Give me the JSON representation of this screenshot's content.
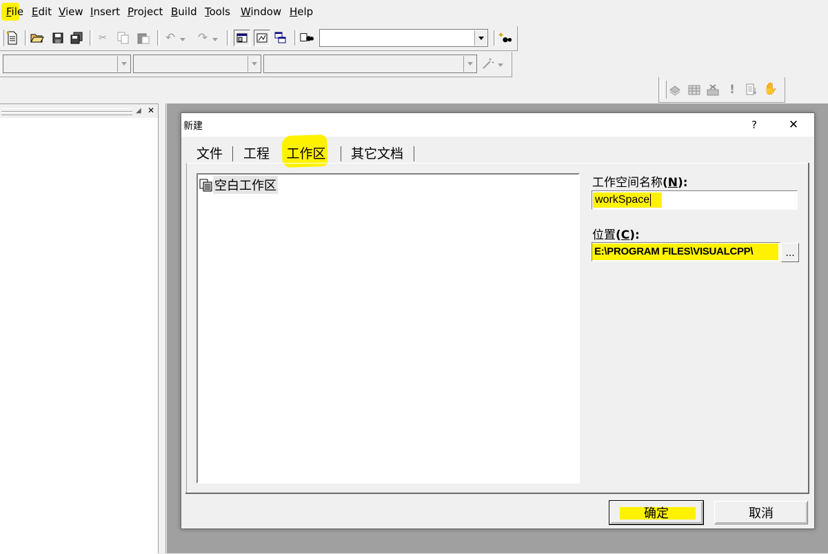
{
  "menu": {
    "items": [
      {
        "label": "File",
        "hotkey": "F",
        "rest": "ile"
      },
      {
        "label": "Edit",
        "hotkey": "E",
        "rest": "dit"
      },
      {
        "label": "View",
        "hotkey": "V",
        "rest": "iew"
      },
      {
        "label": "Insert",
        "hotkey": "I",
        "rest": "nsert"
      },
      {
        "label": "Project",
        "hotkey": "P",
        "rest": "roject"
      },
      {
        "label": "Build",
        "hotkey": "B",
        "rest": "uild"
      },
      {
        "label": "Tools",
        "hotkey": "T",
        "rest": "ools"
      },
      {
        "label": "Window",
        "hotkey": "W",
        "rest": "indow"
      },
      {
        "label": "Help",
        "hotkey": "H",
        "rest": "elp"
      }
    ],
    "highlight_color": "#fff200"
  },
  "toolbar": {
    "icons": [
      "new-text-file-icon",
      "open-folder-icon",
      "save-icon",
      "save-all-icon",
      "cut-icon",
      "copy-icon",
      "paste-icon",
      "undo-icon",
      "redo-icon",
      "workspace-window-icon",
      "output-window-icon",
      "window-list-icon",
      "find-in-files-icon",
      "find-icon"
    ],
    "build_icons": [
      "compile-icon",
      "build-icon",
      "stop-build-icon",
      "execute-icon",
      "go-icon",
      "breakpoint-icon"
    ]
  },
  "dialog": {
    "title": "新建",
    "help_label": "?",
    "close_label": "✕",
    "tabs": [
      {
        "label": "文件",
        "active": false
      },
      {
        "label": "工程",
        "active": false
      },
      {
        "label": "工作区",
        "active": true
      },
      {
        "label": "其它文档",
        "active": false
      }
    ],
    "list": {
      "items": [
        {
          "label": "空白工作区",
          "icon": "blank-workspace-icon"
        }
      ]
    },
    "workspace_name": {
      "label": "工作空间名称",
      "hotkey": "N",
      "value": "workSpace"
    },
    "location": {
      "label": "位置",
      "hotkey": "C",
      "value": "E:\\PROGRAM FILES\\VISUALCPP\\"
    },
    "browse_label": "...",
    "ok_label": "确定",
    "cancel_label": "取消"
  }
}
